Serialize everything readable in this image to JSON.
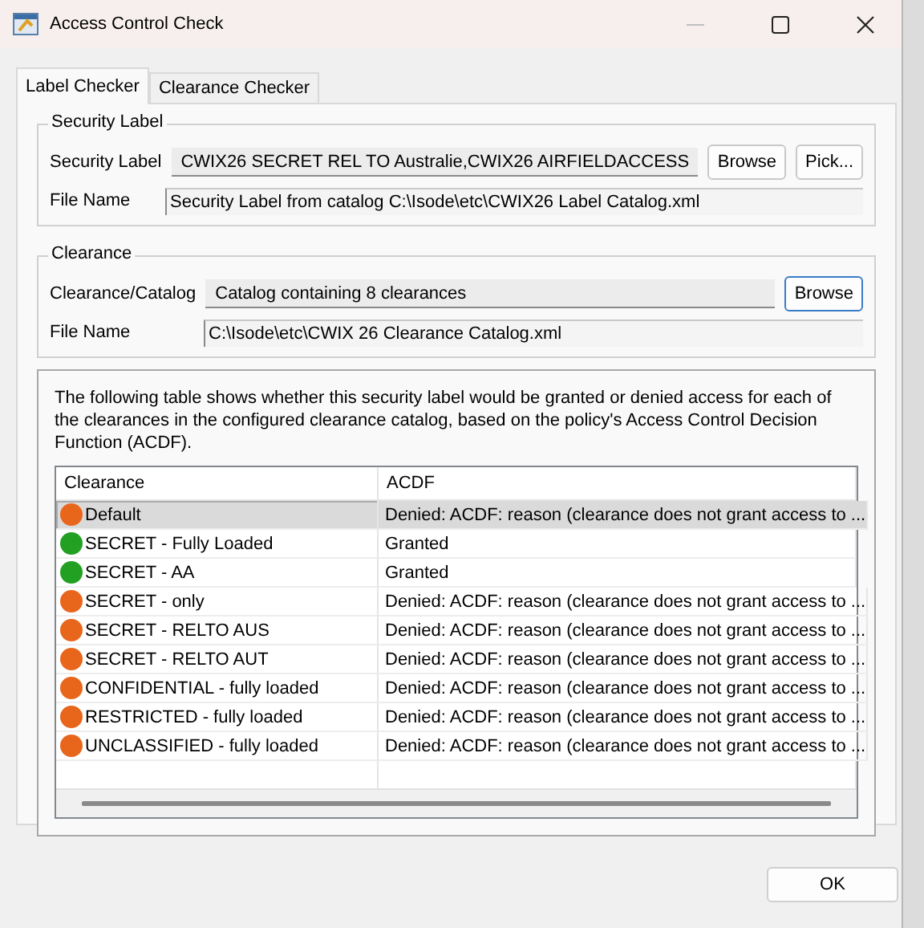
{
  "window": {
    "title": "Access Control Check"
  },
  "tabs": [
    {
      "label": "Label Checker",
      "selected": true
    },
    {
      "label": "Clearance Checker",
      "selected": false
    }
  ],
  "security_label": {
    "legend": "Security Label",
    "label_row": {
      "label": "Security Label",
      "value": "CWIX26  SECRET REL TO Australie,CWIX26 AIRFIELDACCESS",
      "buttons": [
        "Browse",
        "Pick..."
      ]
    },
    "file_row": {
      "label": "File Name",
      "value": "Security Label from catalog C:\\Isode\\etc\\CWIX26 Label Catalog.xml"
    }
  },
  "clearance": {
    "legend": "Clearance",
    "catalog_row": {
      "label": "Clearance/Catalog",
      "value": "Catalog containing 8 clearances",
      "buttons": [
        "Browse"
      ]
    },
    "file_row": {
      "label": "File Name",
      "value": "C:\\Isode\\etc\\CWIX 26 Clearance Catalog.xml"
    }
  },
  "description": "The following table shows whether this security label would be granted or denied access for each of the clearances in the configured clearance catalog, based on the policy's Access Control Decision Function (ACDF).",
  "table": {
    "columns": [
      "Clearance",
      "ACDF"
    ],
    "rows": [
      {
        "clearance": "Default",
        "acdf": "Denied: ACDF: reason (clearance does not grant access to ...",
        "color": "#e8661c",
        "selected": true
      },
      {
        "clearance": "SECRET - Fully Loaded",
        "acdf": "Granted",
        "color": "#22a022",
        "selected": false
      },
      {
        "clearance": "SECRET - AA",
        "acdf": "Granted",
        "color": "#22a022",
        "selected": false
      },
      {
        "clearance": "SECRET  - only",
        "acdf": "Denied: ACDF: reason (clearance does not grant access to ...",
        "color": "#e8661c",
        "selected": false
      },
      {
        "clearance": "SECRET - RELTO AUS",
        "acdf": "Denied: ACDF: reason (clearance does not grant access to ...",
        "color": "#e8661c",
        "selected": false
      },
      {
        "clearance": "SECRET - RELTO AUT",
        "acdf": "Denied: ACDF: reason (clearance does not grant access to ...",
        "color": "#e8661c",
        "selected": false
      },
      {
        "clearance": "CONFIDENTIAL - fully loaded",
        "acdf": "Denied: ACDF: reason (clearance does not grant access to ...",
        "color": "#e8661c",
        "selected": false
      },
      {
        "clearance": "RESTRICTED - fully loaded",
        "acdf": "Denied: ACDF: reason (clearance does not grant access to ...",
        "color": "#e8661c",
        "selected": false
      },
      {
        "clearance": "UNCLASSIFIED - fully loaded",
        "acdf": "Denied: ACDF: reason (clearance does not grant access to ...",
        "color": "#e8661c",
        "selected": false
      }
    ]
  },
  "buttons": [
    "OK"
  ]
}
